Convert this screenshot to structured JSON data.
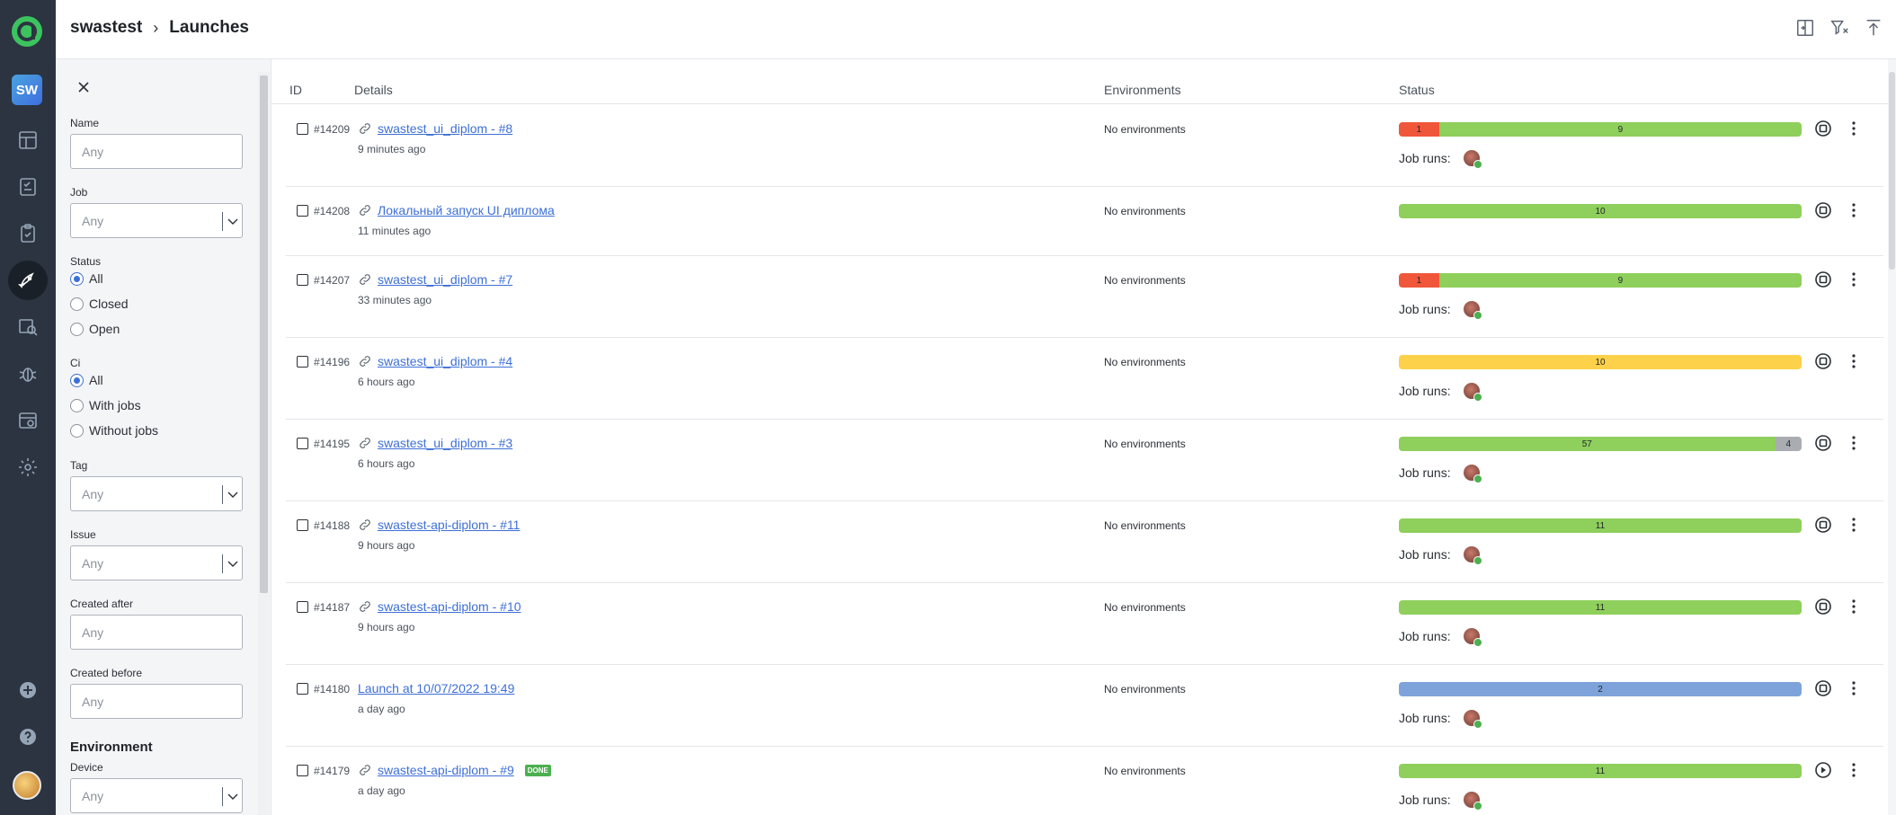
{
  "header": {
    "project": "swastest",
    "page": "Launches"
  },
  "sidebar": {
    "project_badge": "SW"
  },
  "filters": {
    "name": {
      "label": "Name",
      "placeholder": "Any"
    },
    "job": {
      "label": "Job",
      "placeholder": "Any"
    },
    "status": {
      "label": "Status",
      "options": [
        "All",
        "Closed",
        "Open"
      ],
      "selected": "All"
    },
    "ci": {
      "label": "Ci",
      "options": [
        "All",
        "With jobs",
        "Without jobs"
      ],
      "selected": "All"
    },
    "tag": {
      "label": "Tag",
      "placeholder": "Any"
    },
    "issue": {
      "label": "Issue",
      "placeholder": "Any"
    },
    "created_after": {
      "label": "Created after",
      "placeholder": "Any"
    },
    "created_before": {
      "label": "Created before",
      "placeholder": "Any"
    },
    "environment_section": "Environment",
    "device": {
      "label": "Device",
      "placeholder": "Any"
    }
  },
  "table": {
    "columns": [
      "ID",
      "Details",
      "Environments",
      "Status"
    ],
    "job_runs_label": "Job runs:",
    "rows": [
      {
        "id": "#14209",
        "name": "swastest_ui_diplom - #8",
        "time": "9 minutes ago",
        "env": "No environments",
        "linked": true,
        "job_runs": true,
        "action": "stop",
        "segments": [
          {
            "value": "1",
            "color": "#f0573a"
          },
          {
            "value": "9",
            "color": "#8fcf5c"
          }
        ]
      },
      {
        "id": "#14208",
        "name": "Локальный запуск UI диплома",
        "time": "11 minutes ago",
        "env": "No environments",
        "linked": true,
        "job_runs": false,
        "action": "stop",
        "segments": [
          {
            "value": "10",
            "color": "#8fcf5c"
          }
        ]
      },
      {
        "id": "#14207",
        "name": "swastest_ui_diplom - #7",
        "time": "33 minutes ago",
        "env": "No environments",
        "linked": true,
        "job_runs": true,
        "action": "stop",
        "segments": [
          {
            "value": "1",
            "color": "#f0573a"
          },
          {
            "value": "9",
            "color": "#8fcf5c"
          }
        ]
      },
      {
        "id": "#14196",
        "name": "swastest_ui_diplom - #4",
        "time": "6 hours ago",
        "env": "No environments",
        "linked": true,
        "job_runs": true,
        "action": "stop",
        "segments": [
          {
            "value": "10",
            "color": "#fdd14a"
          }
        ]
      },
      {
        "id": "#14195",
        "name": "swastest_ui_diplom - #3",
        "time": "6 hours ago",
        "env": "No environments",
        "linked": true,
        "job_runs": true,
        "action": "stop",
        "segments": [
          {
            "value": "57",
            "color": "#8fcf5c"
          },
          {
            "value": "4",
            "color": "#a9acb1"
          }
        ]
      },
      {
        "id": "#14188",
        "name": "swastest-api-diplom - #11",
        "time": "9 hours ago",
        "env": "No environments",
        "linked": true,
        "job_runs": true,
        "action": "stop",
        "segments": [
          {
            "value": "11",
            "color": "#8fcf5c"
          }
        ]
      },
      {
        "id": "#14187",
        "name": "swastest-api-diplom - #10",
        "time": "9 hours ago",
        "env": "No environments",
        "linked": true,
        "job_runs": true,
        "action": "stop",
        "segments": [
          {
            "value": "11",
            "color": "#8fcf5c"
          }
        ]
      },
      {
        "id": "#14180",
        "name": "Launch at 10/07/2022 19:49",
        "time": "a day ago",
        "env": "No environments",
        "linked": false,
        "job_runs": true,
        "action": "stop",
        "segments": [
          {
            "value": "2",
            "color": "#7ea3da"
          }
        ]
      },
      {
        "id": "#14179",
        "name": "swastest-api-diplom - #9",
        "time": "a day ago",
        "env": "No environments",
        "linked": true,
        "job_runs": true,
        "action": "play",
        "badge": "DONE",
        "segments": [
          {
            "value": "11",
            "color": "#8fcf5c"
          }
        ]
      }
    ]
  }
}
